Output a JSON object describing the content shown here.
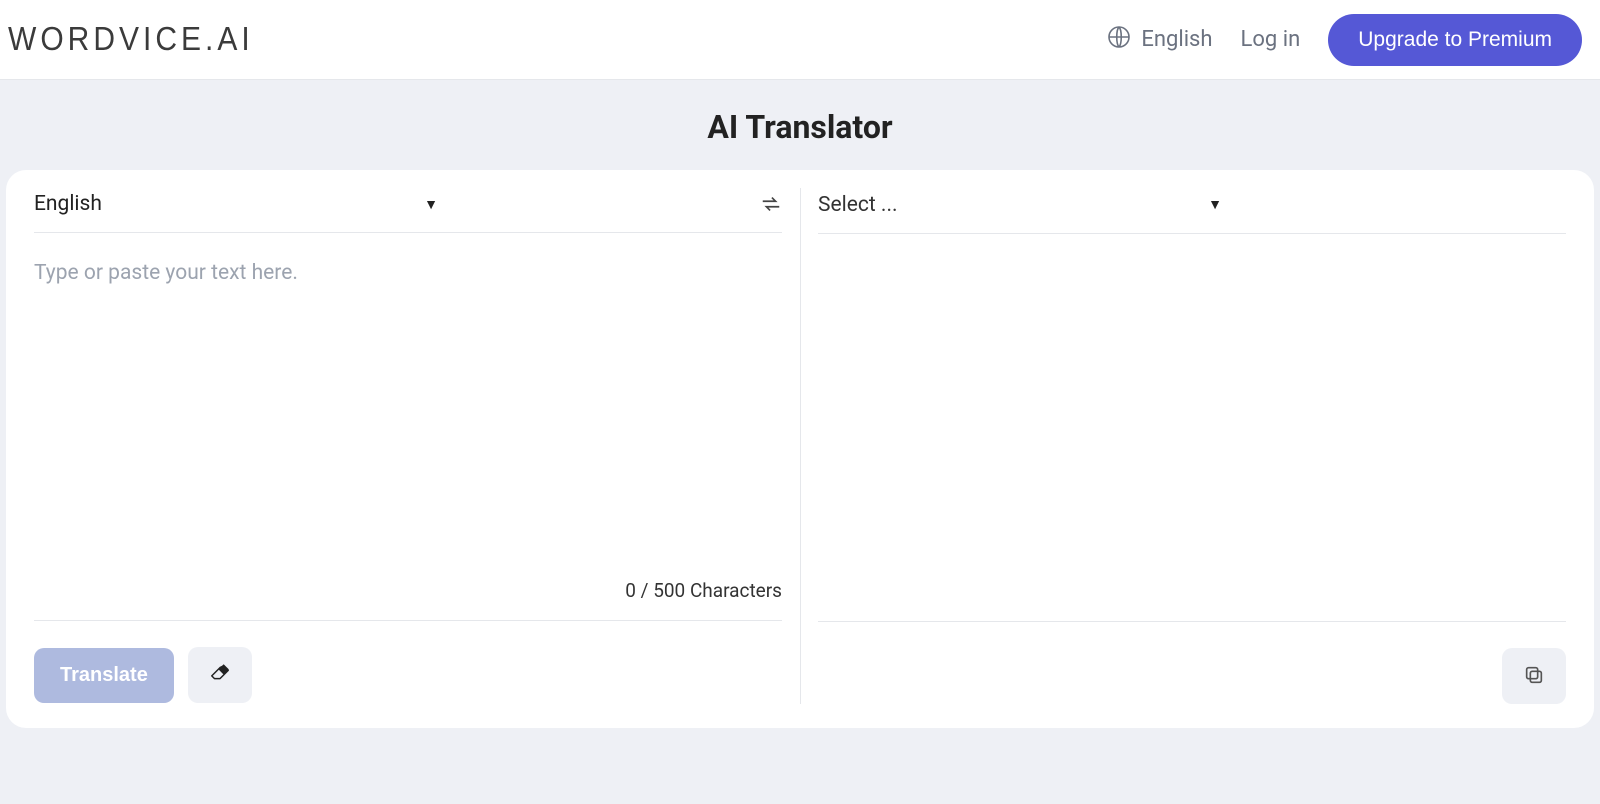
{
  "header": {
    "logo_text": "WORDVICE.AI",
    "lang_label": "English",
    "login_label": "Log in",
    "upgrade_label": "Upgrade to Premium"
  },
  "page": {
    "title": "AI Translator"
  },
  "source": {
    "language_label": "English",
    "placeholder": "Type or paste your text here.",
    "char_count": "0 / 500 Characters",
    "translate_button": "Translate"
  },
  "target": {
    "language_label": "Select ..."
  }
}
